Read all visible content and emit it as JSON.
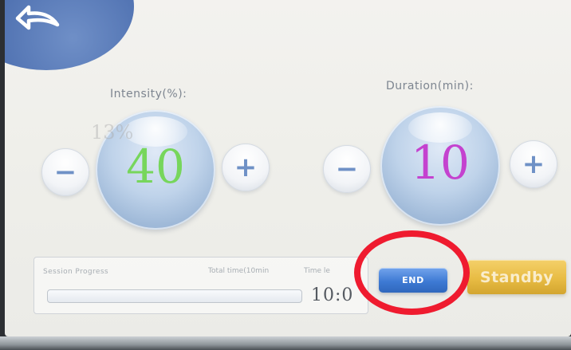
{
  "header": {
    "back_icon": "back-arrow-icon"
  },
  "intensity": {
    "label": "Intensity(%):",
    "value": "40",
    "previous_value": "13%",
    "minus_label": "−",
    "plus_label": "+"
  },
  "duration": {
    "label": "Duration(min):",
    "value": "10",
    "minus_label": "−",
    "plus_label": "+"
  },
  "session": {
    "title": "Session Progress",
    "total_time_label": "Total time(10min",
    "time_left_label": "Time le",
    "time_left_value": "10:0",
    "progress_fraction": 0
  },
  "actions": {
    "end_label": "END",
    "standby_label": "Standby"
  },
  "colors": {
    "intensity_value": "#77d65c",
    "duration_value": "#c442cf",
    "primary_blue": "#4f80d8",
    "standby_gold": "#e8bc44",
    "highlight_red": "#ef1b2f"
  }
}
